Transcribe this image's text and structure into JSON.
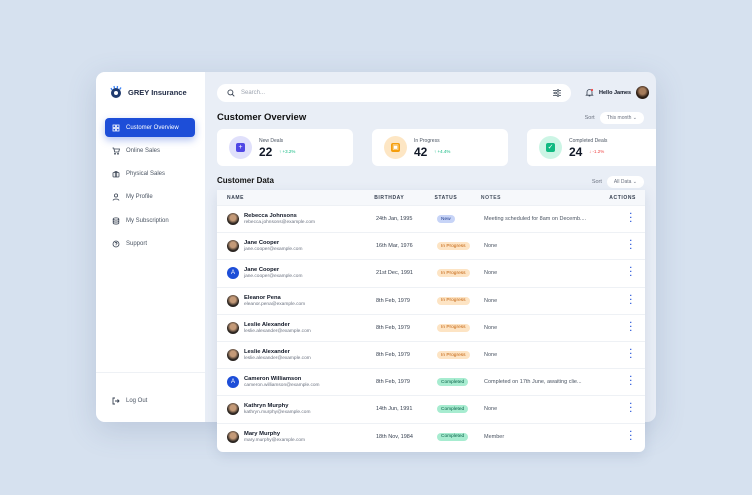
{
  "brand": "GREY Insurance",
  "nav": [
    {
      "label": "Customer Overview",
      "icon": "grid-icon",
      "active": true
    },
    {
      "label": "Online Sales",
      "icon": "cart-icon"
    },
    {
      "label": "Physical Sales",
      "icon": "store-icon"
    },
    {
      "label": "My Profile",
      "icon": "user-icon"
    },
    {
      "label": "My Subscription",
      "icon": "database-icon"
    },
    {
      "label": "Support",
      "icon": "help-icon"
    }
  ],
  "logout": "Log Out",
  "search": {
    "placeholder": "Search..."
  },
  "user": {
    "greeting": "Hello James"
  },
  "overview": {
    "title": "Customer Overview",
    "sort_label": "Sort",
    "sort_value": "This month ⌄",
    "cards": [
      {
        "label": "New Deals",
        "value": "22",
        "delta": "↑ +3.2%",
        "color": "#4f46e5",
        "bg": "#e0e0fb",
        "deltaColor": "#10b981"
      },
      {
        "label": "In Progress",
        "value": "42",
        "delta": "↑ +4.4%",
        "color": "#f59e0b",
        "bg": "#fde6c4",
        "deltaColor": "#10b981"
      },
      {
        "label": "Completed Deals",
        "value": "24",
        "delta": "↓ -1.2%",
        "color": "#10b981",
        "bg": "#ccf5e5",
        "deltaColor": "#ef4444"
      }
    ]
  },
  "customers": {
    "title": "Customer Data",
    "sort_label": "Sort",
    "sort_value": "All Data ⌄",
    "columns": [
      "NAME",
      "BIRTHDAY",
      "STATUS",
      "NOTES",
      "ACTIONS"
    ],
    "rows": [
      {
        "name": "Rebecca Johnsons",
        "email": "rebecca.johnsons@example.com",
        "birthday": "24th Jan, 1995",
        "status": "New",
        "notes": "Meeting scheduled for 8am on Decemb....",
        "avatar": "photo"
      },
      {
        "name": "Jane Cooper",
        "email": "jane.cooper@example.com",
        "birthday": "16th Mar, 1976",
        "status": "In Progress",
        "notes": "None",
        "avatar": "photo"
      },
      {
        "name": "Jane Cooper",
        "email": "jane.cooper@example.com",
        "birthday": "21st Dec, 1991",
        "status": "In Progress",
        "notes": "None",
        "avatar": "A"
      },
      {
        "name": "Eleanor Pena",
        "email": "eleanor.pena@example.com",
        "birthday": "8th Feb, 1979",
        "status": "In Progress",
        "notes": "None",
        "avatar": "photo"
      },
      {
        "name": "Leslie Alexander",
        "email": "leslie.alexander@example.com",
        "birthday": "8th Feb, 1979",
        "status": "In Progress",
        "notes": "None",
        "avatar": "photo"
      },
      {
        "name": "Leslie Alexander",
        "email": "leslie.alexander@example.com",
        "birthday": "8th Feb, 1979",
        "status": "In Progress",
        "notes": "None",
        "avatar": "photo"
      },
      {
        "name": "Cameron Williamson",
        "email": "cameron.williamson@example.com",
        "birthday": "8th Feb, 1979",
        "status": "Completed",
        "notes": "Completed on 17th June, awaiting clie...",
        "avatar": "A"
      },
      {
        "name": "Kathryn Murphy",
        "email": "kathryn.murphy@example.com",
        "birthday": "14th Jun, 1991",
        "status": "Completed",
        "notes": "None",
        "avatar": "photo"
      },
      {
        "name": "Mary Murphy",
        "email": "mary.murphy@example.com",
        "birthday": "18th Nov, 1984",
        "status": "Completed",
        "notes": "Member",
        "avatar": "photo"
      }
    ]
  }
}
